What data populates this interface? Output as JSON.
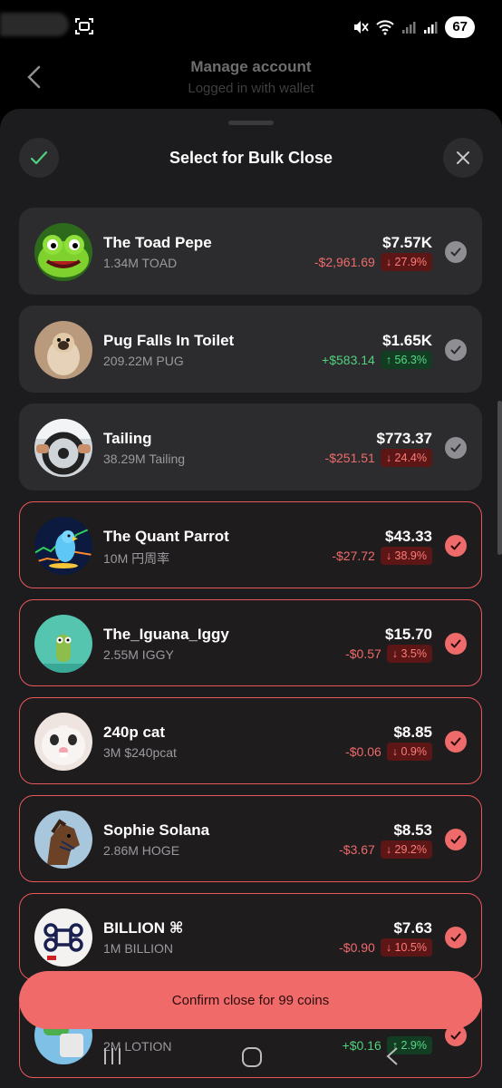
{
  "status": {
    "battery": "67"
  },
  "header": {
    "title": "Manage account",
    "subtitle": "Logged in with wallet"
  },
  "sheet": {
    "title": "Select for Bulk Close"
  },
  "coins": [
    {
      "name": "The Toad Pepe",
      "amount": "1.34M TOAD",
      "value": "$7.57K",
      "pnl": "-$2,961.69",
      "pct": "↓ 27.9%",
      "direction": "neg",
      "selected": false,
      "avatar": "toad-avatar"
    },
    {
      "name": "Pug Falls In Toilet",
      "amount": "209.22M PUG",
      "value": "$1.65K",
      "pnl": "+$583.14",
      "pct": "↑ 56.3%",
      "direction": "pos",
      "selected": false,
      "avatar": "pug-avatar"
    },
    {
      "name": "Tailing",
      "amount": "38.29M Tailing",
      "value": "$773.37",
      "pnl": "-$251.51",
      "pct": "↓ 24.4%",
      "direction": "neg",
      "selected": false,
      "avatar": "driver-avatar"
    },
    {
      "name": "The Quant Parrot",
      "amount": "10M 円周率",
      "value": "$43.33",
      "pnl": "-$27.72",
      "pct": "↓ 38.9%",
      "direction": "neg",
      "selected": true,
      "avatar": "parrot-avatar"
    },
    {
      "name": "The_Iguana_Iggy",
      "amount": "2.55M IGGY",
      "value": "$15.70",
      "pnl": "-$0.57",
      "pct": "↓ 3.5%",
      "direction": "neg",
      "selected": true,
      "avatar": "iguana-avatar"
    },
    {
      "name": "240p cat",
      "amount": "3M $240pcat",
      "value": "$8.85",
      "pnl": "-$0.06",
      "pct": "↓ 0.9%",
      "direction": "neg",
      "selected": true,
      "avatar": "cat-avatar"
    },
    {
      "name": "Sophie Solana",
      "amount": "2.86M HOGE",
      "value": "$8.53",
      "pnl": "-$3.67",
      "pct": "↓ 29.2%",
      "direction": "neg",
      "selected": true,
      "avatar": "horse-avatar"
    },
    {
      "name": "BILLION ⌘",
      "amount": "1M BILLION",
      "value": "$7.63",
      "pnl": "-$0.90",
      "pct": "↓ 10.5%",
      "direction": "neg",
      "selected": true,
      "avatar": "command-avatar"
    },
    {
      "name": "",
      "amount": "2M LOTION",
      "value": "",
      "pnl": "+$0.16",
      "pct": "↑ 2.9%",
      "direction": "pos",
      "selected": true,
      "avatar": "lotion-avatar"
    }
  ],
  "confirm": {
    "label": "Confirm close for 99 coins"
  },
  "colors": {
    "accent": "#f06a6a",
    "positive": "#4fd17d",
    "negative": "#ef6a6a",
    "sheet": "#1c1c1e",
    "card": "#2c2c2e"
  }
}
